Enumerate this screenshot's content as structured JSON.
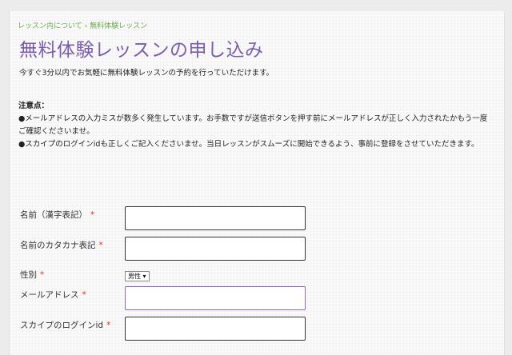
{
  "breadcrumb": {
    "parent": "レッスン内について",
    "separator": "›",
    "current": "無料体験レッスン"
  },
  "page_title": "無料体験レッスンの申し込み",
  "intro": "今すぐ3分以内でお気軽に無料体験レッスンの予約を行っていただけます。",
  "notes": {
    "heading": "注意点：",
    "line1": "●メールアドレスの入力ミスが数多く発生しています。お手数ですが送信ボタンを押す前にメールアドレスが正しく入力されたかもう一度ご確認くださいませ。",
    "line2": "●スカイプのログインidも正しくご記入くださいませ。当日レッスンがスムーズに開始できるよう、事前に登録をさせていただきます。"
  },
  "form": {
    "required_mark": "*",
    "name_kanji_label": "名前（漢字表記）",
    "name_kana_label": "名前のカタカナ表記",
    "gender_label": "性別",
    "gender_selected": "男性",
    "gender_arrow": "▾",
    "email_label": "メールアドレス",
    "skype_label": "スカイプのログインid"
  },
  "colors": {
    "title": "#7b5ea7",
    "breadcrumb": "#6aa84f",
    "required": "#e03030",
    "focus_border": "#8a64c0"
  }
}
